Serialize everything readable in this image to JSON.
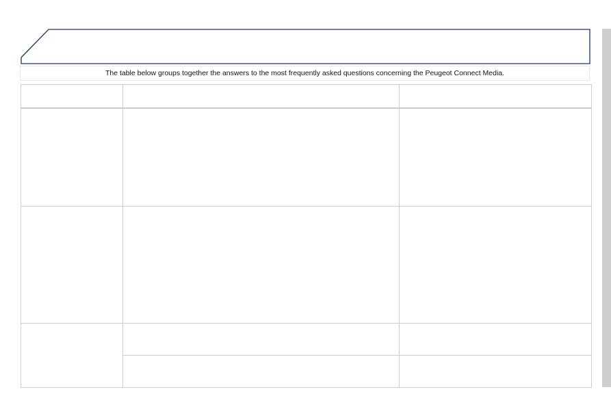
{
  "intro": {
    "text": "The table below groups together the answers to the most frequently asked questions concerning the Peugeot Connect Media."
  },
  "banner": {
    "title": "",
    "border_color": "#1a3560"
  },
  "table": {
    "headers": [
      "",
      "",
      ""
    ],
    "rows": [
      [
        "",
        "",
        ""
      ],
      [
        "",
        "",
        ""
      ],
      [
        "",
        "",
        ""
      ],
      [
        "",
        ""
      ]
    ]
  }
}
